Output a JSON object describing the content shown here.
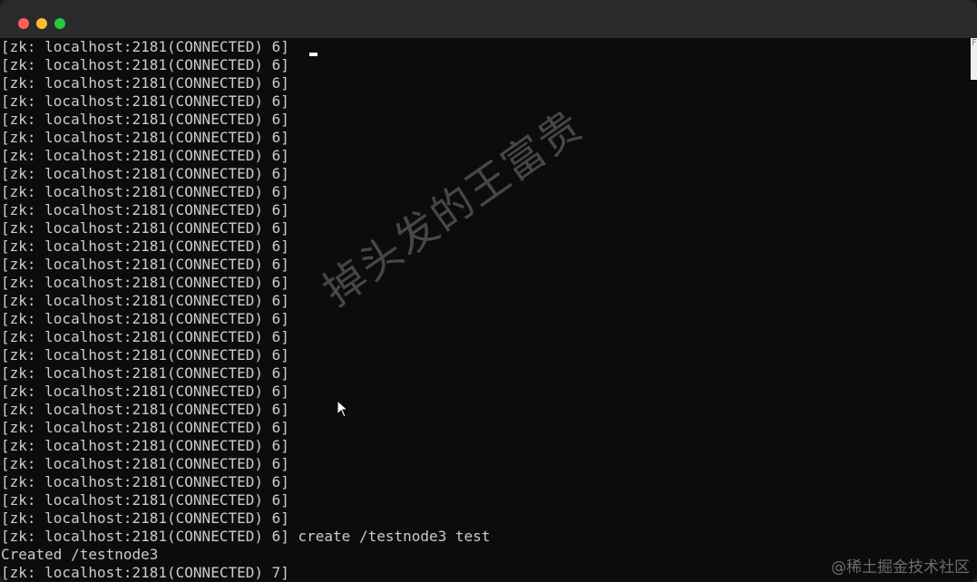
{
  "window": {
    "traffic_lights": [
      "close-icon",
      "minimize-icon",
      "maximize-icon"
    ]
  },
  "terminal": {
    "lines": [
      "[zk: localhost:2181(CONNECTED) 6]",
      "[zk: localhost:2181(CONNECTED) 6]",
      "[zk: localhost:2181(CONNECTED) 6]",
      "[zk: localhost:2181(CONNECTED) 6]",
      "[zk: localhost:2181(CONNECTED) 6]",
      "[zk: localhost:2181(CONNECTED) 6]",
      "[zk: localhost:2181(CONNECTED) 6]",
      "[zk: localhost:2181(CONNECTED) 6]",
      "[zk: localhost:2181(CONNECTED) 6]",
      "[zk: localhost:2181(CONNECTED) 6]",
      "[zk: localhost:2181(CONNECTED) 6]",
      "[zk: localhost:2181(CONNECTED) 6]",
      "[zk: localhost:2181(CONNECTED) 6]",
      "[zk: localhost:2181(CONNECTED) 6]",
      "[zk: localhost:2181(CONNECTED) 6]",
      "[zk: localhost:2181(CONNECTED) 6]",
      "[zk: localhost:2181(CONNECTED) 6]",
      "[zk: localhost:2181(CONNECTED) 6]",
      "[zk: localhost:2181(CONNECTED) 6]",
      "[zk: localhost:2181(CONNECTED) 6]",
      "[zk: localhost:2181(CONNECTED) 6]",
      "[zk: localhost:2181(CONNECTED) 6]",
      "[zk: localhost:2181(CONNECTED) 6]",
      "[zk: localhost:2181(CONNECTED) 6]",
      "[zk: localhost:2181(CONNECTED) 6]",
      "[zk: localhost:2181(CONNECTED) 6]",
      "[zk: localhost:2181(CONNECTED) 6]",
      "[zk: localhost:2181(CONNECTED) 6] create /testnode3 test",
      "Created /testnode3",
      "[zk: localhost:2181(CONNECTED) 7]"
    ]
  },
  "scrollbar": {
    "mark": "F"
  },
  "watermark": {
    "text": "掉头发的王富贵"
  },
  "credit": {
    "text": "@稀土掘金技术社区"
  },
  "colors": {
    "background": "#0c0c0c",
    "text": "#cccccc",
    "titlebar": "#2b2b2b"
  }
}
